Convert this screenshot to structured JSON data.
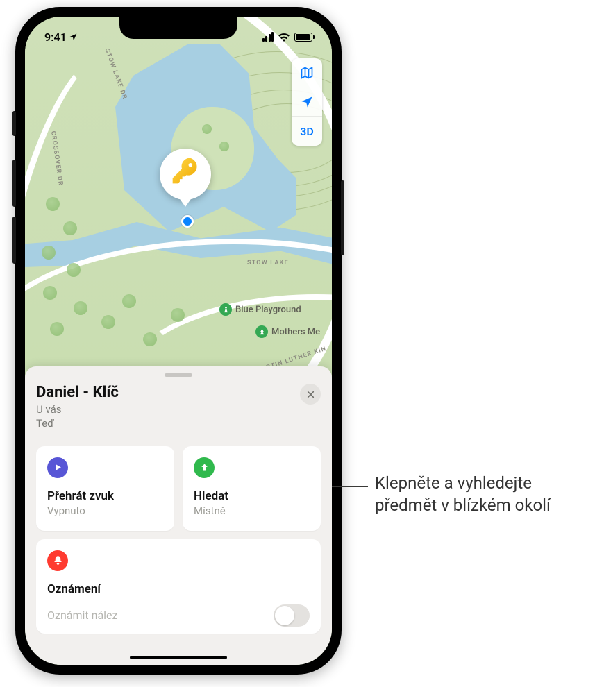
{
  "status": {
    "time": "9:41"
  },
  "map": {
    "roads": {
      "crossover": "Crossover Dr",
      "stow_lake": "Stow Lake Dr",
      "stow_lake2": "Stow Lake",
      "mlk": "Martin Luther Kin"
    },
    "pois": {
      "blue_playground": "Blue Playground",
      "mothers": "Mothers Me"
    },
    "controls": {
      "three_d": "3D"
    }
  },
  "pin": {
    "icon": "key-icon"
  },
  "sheet": {
    "title": "Daniel - Klíč",
    "subtitle1": "U vás",
    "subtitle2": "Teď",
    "cards": {
      "play": {
        "title": "Přehrát zvuk",
        "sub": "Vypnuto"
      },
      "find": {
        "title": "Hledat",
        "sub": "Místně"
      },
      "notif": {
        "title": "Oznámení"
      },
      "notify_found": "Oznámit nález"
    }
  },
  "annotation": "Klepněte a vyhledejte předmět v blízkém okolí"
}
